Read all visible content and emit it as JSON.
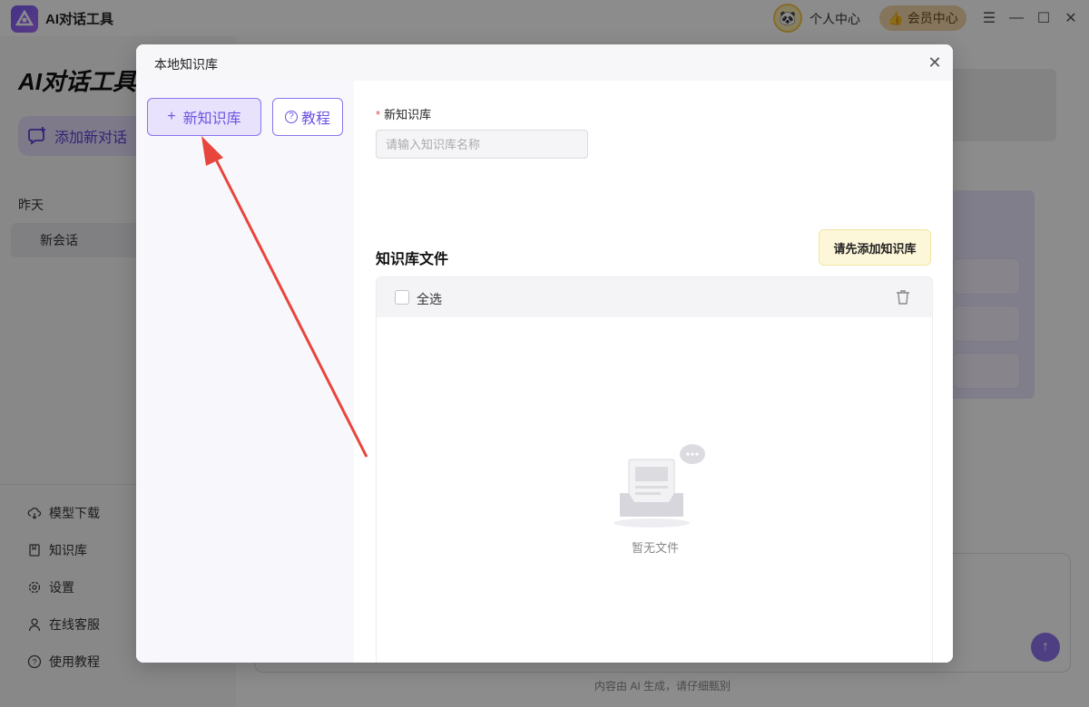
{
  "app": {
    "name": "AI对话工具",
    "user_center": "个人中心",
    "vip_label": "会员中心"
  },
  "sidebar": {
    "title": "AI对话工具",
    "add_chat": "添加新对话",
    "section_label": "昨天",
    "session": "新会话",
    "nav": [
      {
        "label": "模型下载",
        "icon": "cloud-download-icon"
      },
      {
        "label": "知识库",
        "icon": "book-icon"
      },
      {
        "label": "设置",
        "icon": "gear-icon"
      },
      {
        "label": "在线客服",
        "icon": "user-icon"
      },
      {
        "label": "使用教程",
        "icon": "help-icon"
      }
    ]
  },
  "footer": {
    "disclaimer": "内容由 AI 生成，请仔细甄别"
  },
  "modal": {
    "title": "本地知识库",
    "new_kb_button": "新知识库",
    "tutorial_button": "教程",
    "field_label": "新知识库",
    "field_placeholder": "请输入知识库名称",
    "field_value": "",
    "files_title": "知识库文件",
    "add_first_button": "请先添加知识库",
    "select_all": "全选",
    "empty_text": "暂无文件"
  },
  "colors": {
    "accent": "#6c52e0",
    "annotation": "#e8453c"
  }
}
